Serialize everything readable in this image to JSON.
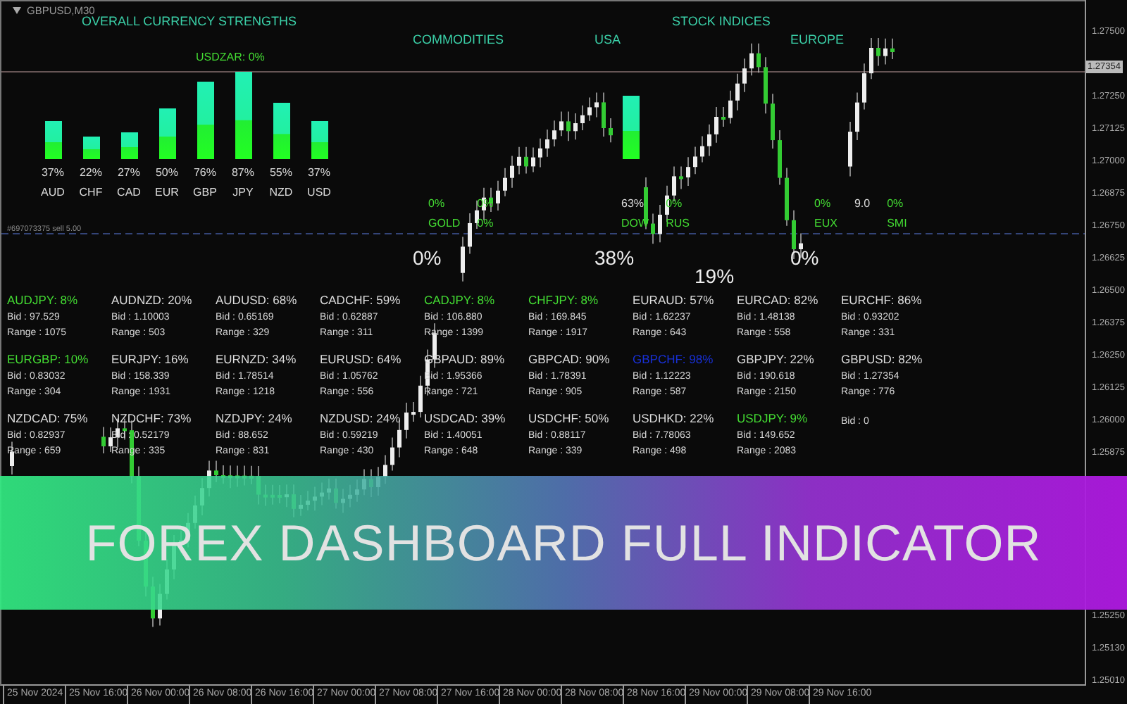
{
  "symbol_label": "GBPUSD,M30",
  "strengths": {
    "title": "OVERALL CURRENCY STRENGTHS",
    "note": "USDZAR: 0%",
    "bars": [
      {
        "currency": "AUD",
        "percent": "37%"
      },
      {
        "currency": "CHF",
        "percent": "22%"
      },
      {
        "currency": "CAD",
        "percent": "27%"
      },
      {
        "currency": "EUR",
        "percent": "50%"
      },
      {
        "currency": "GBP",
        "percent": "76%"
      },
      {
        "currency": "JPY",
        "percent": "87%"
      },
      {
        "currency": "NZD",
        "percent": "55%"
      },
      {
        "currency": "USD",
        "percent": "37%"
      }
    ]
  },
  "commodities": {
    "title": "COMMODITIES",
    "items": [
      {
        "value": "0%",
        "name": "GOLD"
      },
      {
        "value": "0%",
        "name": "0%"
      }
    ]
  },
  "stock_indices": {
    "title": "STOCK INDICES",
    "usa": {
      "title": "USA",
      "items": [
        {
          "value": "63%",
          "name": "DOW"
        },
        {
          "value": "0%",
          "name": "RUS"
        }
      ]
    },
    "europe": {
      "title": "EUROPE",
      "items": [
        {
          "value": "0%",
          "name": "EUX"
        },
        {
          "value": "9.0"
        },
        {
          "value": "0%",
          "name": "SMI"
        }
      ]
    }
  },
  "big_readings": [
    "0%",
    "38%",
    "19%",
    "0%"
  ],
  "order_label": "#697073375 sell 5.00",
  "pairs": [
    {
      "name": "AUDJPY: 8%",
      "color": "#44dd33",
      "bid": "Bid : 97.529",
      "range": "Range : 1075"
    },
    {
      "name": "AUDNZD: 20%",
      "color": "#dddddd",
      "bid": "Bid : 1.10003",
      "range": "Range : 503"
    },
    {
      "name": "AUDUSD: 68%",
      "color": "#dddddd",
      "bid": "Bid : 0.65169",
      "range": "Range : 329"
    },
    {
      "name": "CADCHF: 59%",
      "color": "#dddddd",
      "bid": "Bid : 0.62887",
      "range": "Range : 311"
    },
    {
      "name": "CADJPY: 8%",
      "color": "#44dd33",
      "bid": "Bid : 106.880",
      "range": "Range : 1399"
    },
    {
      "name": "CHFJPY: 8%",
      "color": "#44dd33",
      "bid": "Bid : 169.845",
      "range": "Range : 1917"
    },
    {
      "name": "EURAUD: 57%",
      "color": "#dddddd",
      "bid": "Bid : 1.62237",
      "range": "Range : 643"
    },
    {
      "name": "EURCAD: 82%",
      "color": "#dddddd",
      "bid": "Bid : 1.48138",
      "range": "Range : 558"
    },
    {
      "name": "EURCHF: 86%",
      "color": "#dddddd",
      "bid": "Bid : 0.93202",
      "range": "Range : 331"
    },
    {
      "name": "EURGBP: 10%",
      "color": "#44dd33",
      "bid": "Bid : 0.83032",
      "range": "Range : 304"
    },
    {
      "name": "EURJPY: 16%",
      "color": "#dddddd",
      "bid": "Bid : 158.339",
      "range": "Range : 1931"
    },
    {
      "name": "EURNZD: 34%",
      "color": "#dddddd",
      "bid": "Bid : 1.78514",
      "range": "Range : 1218"
    },
    {
      "name": "EURUSD: 64%",
      "color": "#dddddd",
      "bid": "Bid : 1.05762",
      "range": "Range : 556"
    },
    {
      "name": "GBPAUD: 89%",
      "color": "#dddddd",
      "bid": "Bid : 1.95366",
      "range": "Range : 721"
    },
    {
      "name": "GBPCAD: 90%",
      "color": "#dddddd",
      "bid": "Bid : 1.78391",
      "range": "Range : 905"
    },
    {
      "name": "GBPCHF: 98%",
      "color": "#1830d8",
      "bid": "Bid : 1.12223",
      "range": "Range : 587"
    },
    {
      "name": "GBPJPY: 22%",
      "color": "#dddddd",
      "bid": "Bid : 190.618",
      "range": "Range : 2150"
    },
    {
      "name": "GBPUSD: 82%",
      "color": "#dddddd",
      "bid": "Bid : 1.27354",
      "range": "Range : 776"
    },
    {
      "name": "NZDCAD: 75%",
      "color": "#dddddd",
      "bid": "Bid : 0.82937",
      "range": "Range : 659"
    },
    {
      "name": "NZDCHF: 73%",
      "color": "#dddddd",
      "bid": "Bid : 0.52179",
      "range": "Range : 335"
    },
    {
      "name": "NZDJPY: 24%",
      "color": "#dddddd",
      "bid": "Bid : 88.652",
      "range": "Range : 831"
    },
    {
      "name": "NZDUSD: 24%",
      "color": "#dddddd",
      "bid": "Bid : 0.59219",
      "range": "Range : 430"
    },
    {
      "name": "USDCAD: 39%",
      "color": "#dddddd",
      "bid": "Bid : 1.40051",
      "range": "Range : 648"
    },
    {
      "name": "USDCHF: 50%",
      "color": "#dddddd",
      "bid": "Bid : 0.88117",
      "range": "Range : 339"
    },
    {
      "name": "USDHKD: 22%",
      "color": "#dddddd",
      "bid": "Bid : 7.78063",
      "range": "Range : 498"
    },
    {
      "name": "USDJPY: 9%",
      "color": "#44dd33",
      "bid": "Bid : 149.652",
      "range": "Range : 2083"
    },
    {
      "bid": "Bid : 0"
    }
  ],
  "price_axis": {
    "upper": [
      {
        "text": "1.27500",
        "kind": "tick"
      },
      {
        "text": "1.27354",
        "kind": "current"
      },
      {
        "text": "1.27250",
        "kind": "tick"
      },
      {
        "text": "1.27125",
        "kind": "tick"
      },
      {
        "text": "1.27000",
        "kind": "tick"
      },
      {
        "text": "1.26875",
        "kind": "tick"
      },
      {
        "text": "1.26750",
        "kind": "tick"
      },
      {
        "text": "1.26625",
        "kind": "tick"
      },
      {
        "text": "1.26500",
        "kind": "tick"
      },
      {
        "text": "1.26375",
        "kind": "tick"
      },
      {
        "text": "1.26250",
        "kind": "tick"
      },
      {
        "text": "1.26125",
        "kind": "tick"
      },
      {
        "text": "1.26000",
        "kind": "tick"
      },
      {
        "text": "1.25875",
        "kind": "tick"
      }
    ],
    "lower": [
      {
        "text": "1.25250",
        "kind": "tick"
      },
      {
        "text": "1.25130",
        "kind": "tick"
      },
      {
        "text": "1.25010",
        "kind": "tick"
      }
    ]
  },
  "time_axis": [
    "25 Nov 2024",
    "25 Nov 16:00",
    "26 Nov 00:00",
    "26 Nov 08:00",
    "26 Nov 16:00",
    "27 Nov 00:00",
    "27 Nov 08:00",
    "27 Nov 16:00",
    "28 Nov 00:00",
    "28 Nov 08:00",
    "28 Nov 16:00",
    "29 Nov 00:00",
    "29 Nov 08:00",
    "29 Nov 16:00"
  ],
  "banner": {
    "title": "FOREX DASHBOARD FULL INDICATOR"
  }
}
